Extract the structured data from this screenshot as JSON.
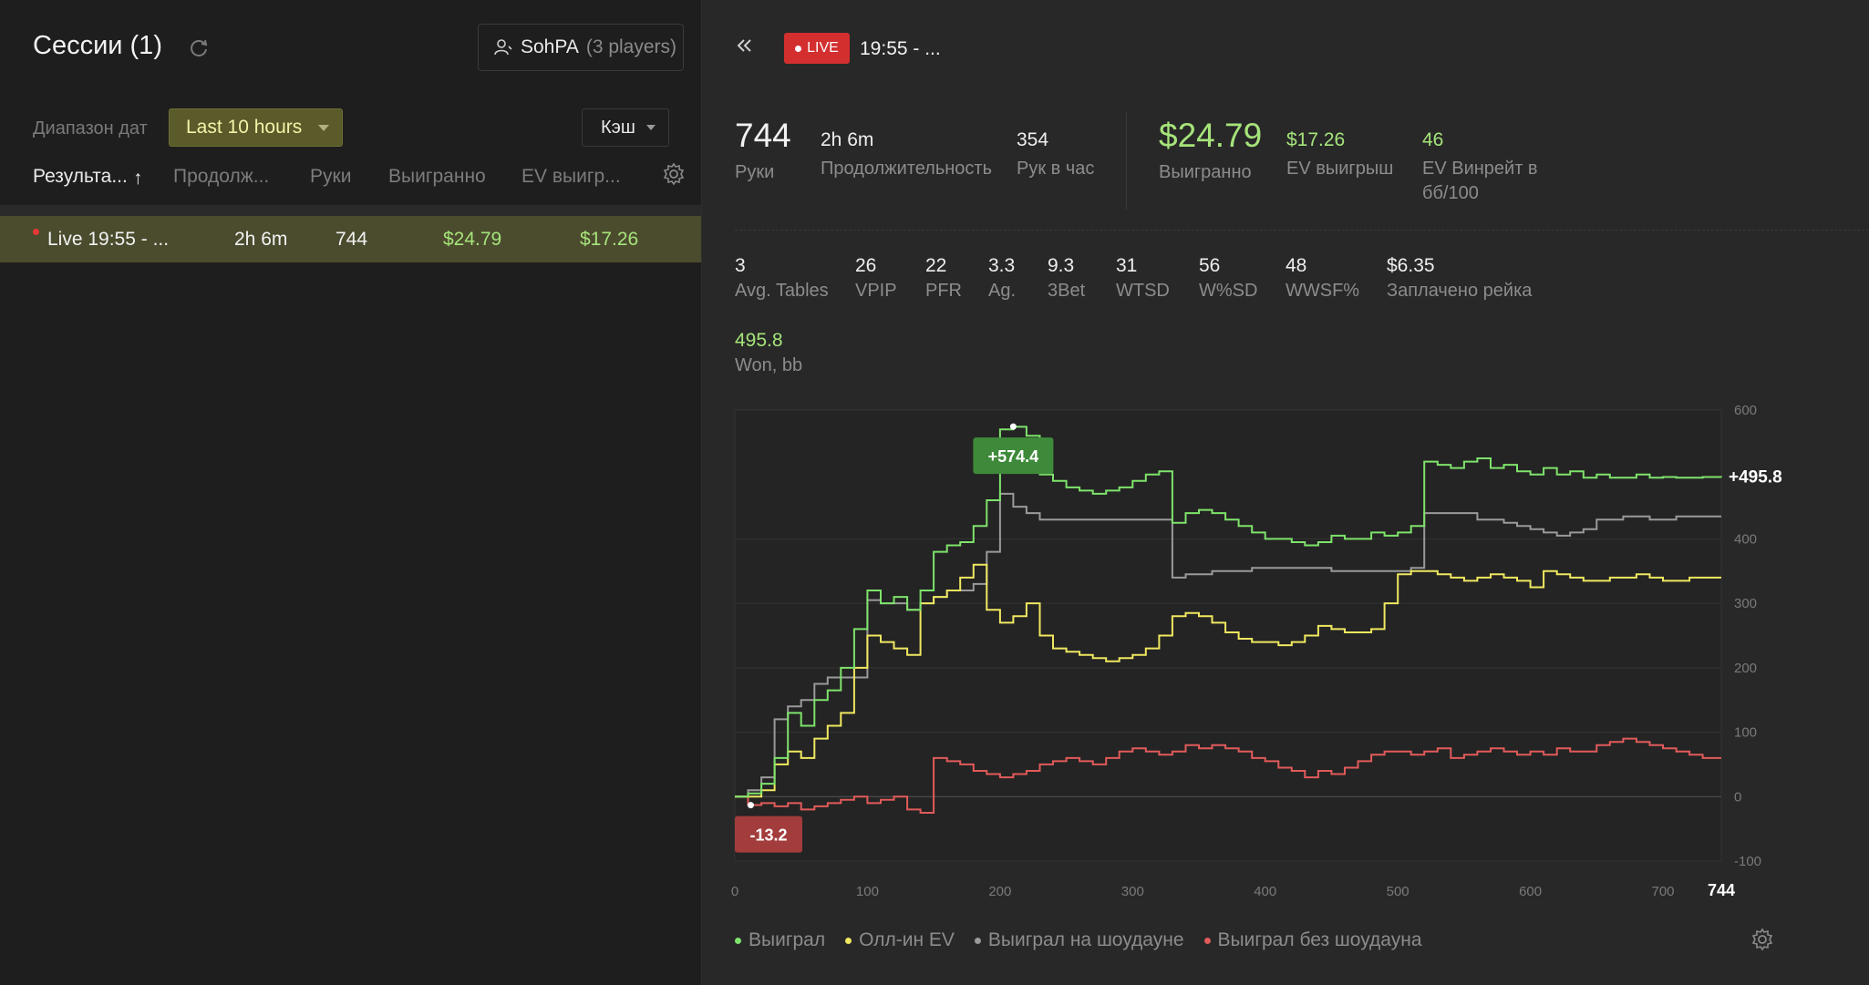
{
  "left": {
    "title": "Сессии (1)",
    "player_name": "SohPA",
    "player_count": "(3 players)",
    "range_label": "Диапазон дат",
    "range_value": "Last 10 hours",
    "game_type": "Кэш",
    "columns": [
      "Результа...",
      "Продолж...",
      "Руки",
      "Выигранно",
      "EV выигр..."
    ],
    "sort_arrow": "↑",
    "session": {
      "name": "Live 19:55 - ...",
      "duration": "2h 6m",
      "hands": "744",
      "won": "$24.79",
      "ev": "$17.26"
    }
  },
  "right": {
    "live_label": "LIVE",
    "session_title": "19:55 - ...",
    "stats": {
      "hands": {
        "value": "744",
        "label": "Руки"
      },
      "duration": {
        "value": "2h 6m",
        "label": "Продолжительность"
      },
      "hands_per_hour": {
        "value": "354",
        "label": "Рук в час"
      },
      "won": {
        "value": "$24.79",
        "label": "Выигранно"
      },
      "ev_won": {
        "value": "$17.26",
        "label": "EV выигрыш"
      },
      "ev_winrate": {
        "value": "46",
        "label": "EV Винрейт в бб/100"
      }
    },
    "stats2": [
      {
        "value": "3",
        "label": "Avg. Tables"
      },
      {
        "value": "26",
        "label": "VPIP"
      },
      {
        "value": "22",
        "label": "PFR"
      },
      {
        "value": "3.3",
        "label": "Ag."
      },
      {
        "value": "9.3",
        "label": "3Bet"
      },
      {
        "value": "31",
        "label": "WTSD"
      },
      {
        "value": "56",
        "label": "W%SD"
      },
      {
        "value": "48",
        "label": "WWSF%"
      },
      {
        "value": "$6.35",
        "label": "Заплачено рейка"
      }
    ],
    "won_bb": {
      "value": "495.8",
      "label": "Won, bb"
    },
    "legend": [
      "Выиграл",
      "Олл-ин EV",
      "Выиграл на шоудауне",
      "Выиграл без шоудауна"
    ]
  },
  "colors": {
    "won": "#7ee36b",
    "allin_ev": "#f0e860",
    "showdown": "#9a9a9a",
    "non_showdown": "#e25a5a",
    "accent_green": "#a6e47a",
    "live_red": "#d32f2f"
  },
  "chart_data": {
    "type": "line",
    "xlim": [
      0,
      744
    ],
    "ylim": [
      -100,
      600
    ],
    "x_ticks": [
      0,
      100,
      200,
      300,
      400,
      500,
      600,
      700
    ],
    "x_max_label": "744",
    "y_ticks": [
      600,
      400,
      300,
      200,
      100,
      0,
      -100
    ],
    "annotations": {
      "max": {
        "label": "+574.4",
        "x": 210,
        "y": 574.4
      },
      "min": {
        "label": "-13.2",
        "x": 12,
        "y": -13.2
      },
      "final": {
        "label": "+495.8",
        "x": 744,
        "y": 495.8
      }
    },
    "series": [
      {
        "name": "Выиграл",
        "x": [
          0,
          10,
          20,
          30,
          40,
          50,
          60,
          70,
          80,
          90,
          100,
          110,
          120,
          130,
          140,
          150,
          160,
          170,
          180,
          190,
          200,
          210,
          220,
          230,
          240,
          250,
          260,
          270,
          280,
          290,
          300,
          310,
          320,
          330,
          340,
          350,
          360,
          370,
          380,
          390,
          400,
          410,
          420,
          430,
          440,
          450,
          460,
          470,
          480,
          490,
          500,
          510,
          520,
          530,
          540,
          550,
          560,
          570,
          580,
          590,
          600,
          610,
          620,
          630,
          640,
          650,
          660,
          670,
          680,
          690,
          700,
          710,
          720,
          730,
          744
        ],
        "y": [
          0,
          5,
          20,
          60,
          130,
          110,
          150,
          165,
          200,
          260,
          320,
          300,
          310,
          290,
          320,
          380,
          390,
          395,
          420,
          460,
          570,
          574,
          560,
          500,
          490,
          480,
          475,
          470,
          475,
          480,
          490,
          500,
          505,
          425,
          440,
          445,
          440,
          430,
          420,
          410,
          400,
          400,
          395,
          390,
          395,
          405,
          400,
          400,
          410,
          405,
          410,
          420,
          520,
          515,
          510,
          520,
          525,
          510,
          515,
          505,
          500,
          510,
          500,
          505,
          495,
          500,
          495,
          495,
          500,
          495,
          496,
          495,
          495,
          496,
          495.8
        ]
      },
      {
        "name": "Олл-ин EV",
        "x": [
          0,
          10,
          20,
          30,
          40,
          50,
          60,
          70,
          80,
          90,
          100,
          110,
          120,
          130,
          140,
          150,
          160,
          170,
          180,
          190,
          200,
          210,
          220,
          230,
          240,
          250,
          260,
          270,
          280,
          290,
          300,
          310,
          320,
          330,
          340,
          350,
          360,
          370,
          380,
          390,
          400,
          410,
          420,
          430,
          440,
          450,
          460,
          470,
          480,
          490,
          500,
          510,
          520,
          530,
          540,
          550,
          560,
          570,
          580,
          590,
          600,
          610,
          620,
          630,
          640,
          650,
          660,
          670,
          680,
          690,
          700,
          710,
          720,
          730,
          744
        ],
        "y": [
          0,
          0,
          10,
          50,
          70,
          60,
          90,
          110,
          130,
          200,
          250,
          240,
          230,
          220,
          300,
          310,
          320,
          340,
          360,
          290,
          270,
          280,
          300,
          250,
          230,
          225,
          220,
          215,
          210,
          215,
          220,
          230,
          250,
          280,
          285,
          280,
          270,
          255,
          245,
          240,
          240,
          235,
          240,
          250,
          265,
          260,
          255,
          255,
          260,
          300,
          345,
          350,
          350,
          345,
          340,
          335,
          340,
          345,
          340,
          335,
          325,
          350,
          345,
          340,
          335,
          335,
          340,
          340,
          345,
          340,
          335,
          335,
          340,
          340,
          340
        ]
      },
      {
        "name": "Выиграл на шоудауне",
        "x": [
          0,
          10,
          20,
          30,
          40,
          50,
          60,
          70,
          80,
          90,
          100,
          110,
          120,
          130,
          140,
          150,
          160,
          170,
          180,
          190,
          200,
          210,
          220,
          230,
          240,
          250,
          260,
          270,
          280,
          290,
          300,
          310,
          320,
          330,
          340,
          350,
          360,
          370,
          380,
          390,
          400,
          410,
          420,
          430,
          440,
          450,
          460,
          470,
          480,
          490,
          500,
          510,
          520,
          530,
          540,
          550,
          560,
          570,
          580,
          590,
          600,
          610,
          620,
          630,
          640,
          650,
          660,
          670,
          680,
          690,
          700,
          710,
          720,
          730,
          744
        ],
        "y": [
          0,
          10,
          30,
          120,
          140,
          150,
          175,
          185,
          185,
          185,
          305,
          300,
          300,
          290,
          300,
          310,
          320,
          320,
          330,
          380,
          470,
          450,
          440,
          430,
          430,
          430,
          430,
          430,
          430,
          430,
          430,
          430,
          430,
          340,
          345,
          345,
          350,
          350,
          350,
          355,
          355,
          355,
          355,
          355,
          355,
          350,
          350,
          350,
          350,
          350,
          350,
          355,
          440,
          440,
          440,
          440,
          430,
          430,
          425,
          420,
          415,
          410,
          405,
          410,
          415,
          430,
          430,
          435,
          435,
          430,
          430,
          435,
          435,
          435,
          435
        ]
      },
      {
        "name": "Выиграл без шоудауна",
        "x": [
          0,
          10,
          20,
          30,
          40,
          50,
          60,
          70,
          80,
          90,
          100,
          110,
          120,
          130,
          140,
          150,
          160,
          170,
          180,
          190,
          200,
          210,
          220,
          230,
          240,
          250,
          260,
          270,
          280,
          290,
          300,
          310,
          320,
          330,
          340,
          350,
          360,
          370,
          380,
          390,
          400,
          410,
          420,
          430,
          440,
          450,
          460,
          470,
          480,
          490,
          500,
          510,
          520,
          530,
          540,
          550,
          560,
          570,
          580,
          590,
          600,
          610,
          620,
          630,
          640,
          650,
          660,
          670,
          680,
          690,
          700,
          710,
          720,
          730,
          744
        ],
        "y": [
          0,
          -13,
          -10,
          -15,
          -10,
          -20,
          -15,
          -10,
          -5,
          0,
          -10,
          -5,
          0,
          -20,
          -25,
          60,
          55,
          50,
          40,
          35,
          30,
          35,
          40,
          50,
          55,
          60,
          55,
          50,
          60,
          70,
          75,
          70,
          65,
          70,
          80,
          75,
          80,
          75,
          70,
          60,
          55,
          45,
          40,
          30,
          40,
          35,
          45,
          55,
          65,
          70,
          70,
          65,
          70,
          75,
          60,
          65,
          70,
          75,
          70,
          65,
          70,
          65,
          75,
          70,
          70,
          80,
          85,
          90,
          85,
          80,
          75,
          70,
          65,
          60,
          60
        ]
      }
    ]
  }
}
